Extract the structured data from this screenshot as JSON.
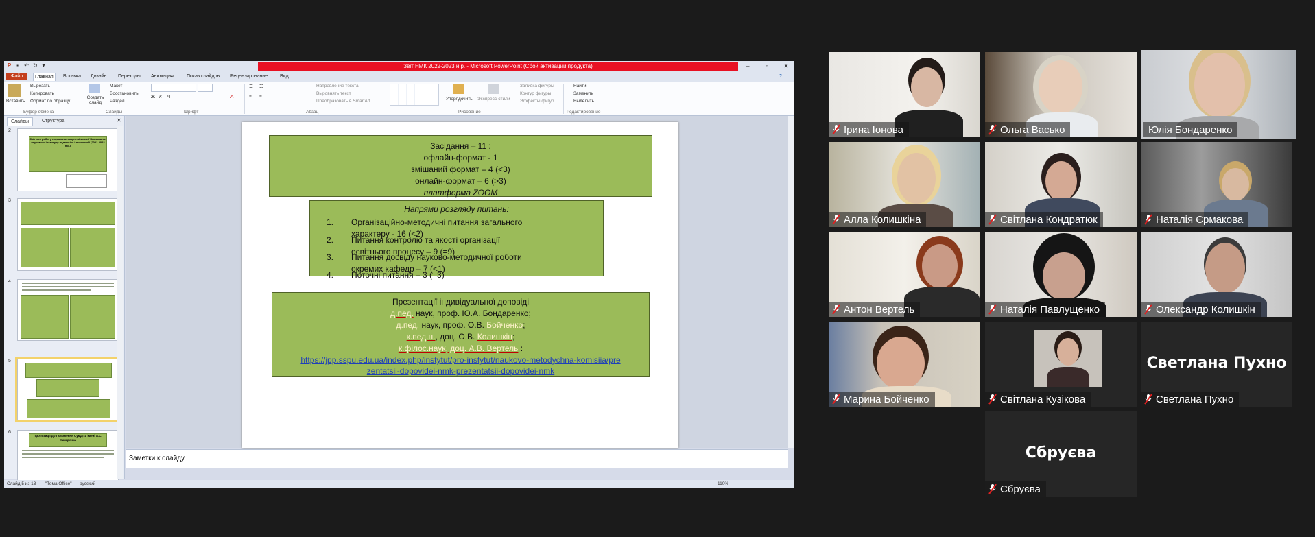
{
  "window": {
    "title": "Звіт НМК 2022-2023 н.р. - Microsoft PowerPoint (Сбой активации продукта)"
  },
  "ribbon": {
    "tabs": [
      "Файл",
      "Главная",
      "Вставка",
      "Дизайн",
      "Переходы",
      "Анимация",
      "Показ слайдов",
      "Рецензирование",
      "Вид"
    ],
    "clipboard": {
      "paste": "Вставить",
      "cut": "Вырезать",
      "copy": "Копировать",
      "format": "Формат по образцу",
      "group": "Буфер обмена"
    },
    "slides": {
      "create": "Создать слайд",
      "layout": "Макет",
      "reset": "Восстановить",
      "section": "Раздел",
      "group": "Слайды"
    },
    "font_group": "Шрифт",
    "paragraph": {
      "dir": "Направление текста",
      "align": "Выровнять текст",
      "smartart": "Преобразовать в SmartArt",
      "group": "Абзац"
    },
    "drawing": {
      "arrange": "Упорядочить",
      "styles": "Экспресс-стили",
      "fill": "Заливка фигуры",
      "outline": "Контур фигуры",
      "effects": "Эффекты фигур",
      "group": "Рисование"
    },
    "editing": {
      "find": "Найти",
      "replace": "Заменить",
      "select": "Выделить",
      "group": "Редактирование"
    }
  },
  "panel": {
    "tabs": [
      "Слайды",
      "Структура"
    ]
  },
  "thumbs": {
    "nums": [
      "2",
      "3",
      "4",
      "5",
      "6"
    ],
    "t2_title": "Звіт про роботу науково-методичної комісії Навчально-наукового інституту педагогіки і психології (2022-2023 н.р.)",
    "t6_title": "Пропозиції до Положення СумДПУ імені А.С. Макаренка"
  },
  "slide": {
    "box1": [
      "Засідання – 11 :",
      "офлайн-формат - 1",
      "змішаний формат – 4 (<3)",
      "онлайн-формат – 6 (>3)",
      "платформа ZOOM"
    ],
    "box2_title": "Напрями розгляду питань:",
    "box2_items": [
      {
        "n": "1.",
        "text": "Організаційно-методичні питання загального характеру - 16 (<2)"
      },
      {
        "n": "2.",
        "text": "Питання контролю та якості організації освітнього процесу – 9 (=9)"
      },
      {
        "n": "3.",
        "text": "Питання досвіду науково-методичної роботи окремих кафедр – 7 (<1)"
      },
      {
        "n": "4.",
        "text": "Поточні питання – 3 (=3)"
      }
    ],
    "box3": {
      "title": "Презентації індивідуальної доповіді",
      "l1_a": "д.пед.",
      "l1_b": " наук, проф. Ю.А. Бондаренко;",
      "l2_a": "д.пед.",
      "l2_b": " наук, проф. О.В. ",
      "l2_c": "Бойченко",
      ";": ";",
      "l3_a": "к.пед.н.",
      "l3_b": ", доц. О.В. ",
      "l3_c": "Колишкін",
      "l4_a": "к.філос.наук",
      "l4_b": ", доц. А.В. Вертель",
      "link": "https://jpp.sspu.edu.ua/index.php/instytut/pro-instytut/naukovo-metodychna-komisiia/prezentatsii-dopovidei-nmk-prezentatsii-dopovidei-nmk"
    }
  },
  "notes_placeholder": "Заметки к слайду",
  "status": {
    "slide": "Слайд 5 из 13",
    "theme": "\"Тема Office\"",
    "lang": "русский",
    "zoom": "110%"
  },
  "participants": [
    {
      "name": "Ірина Іонова"
    },
    {
      "name": "Ольга Васько"
    },
    {
      "name": "Юлія Бондаренко"
    },
    {
      "name": "Алла Колишкіна"
    },
    {
      "name": "Світлана Кондратюк"
    },
    {
      "name": "Наталія  Єрмакова"
    },
    {
      "name": "Антон Вертель"
    },
    {
      "name": "Наталія Павлущенко"
    },
    {
      "name": "Олександр Колишкін"
    },
    {
      "name": "Марина Бойченко"
    },
    {
      "name": "Світлана Кузікова"
    },
    {
      "name": "Светлана Пухно",
      "big": "Светлана Пухно"
    },
    {
      "name": "Сбруєва",
      "big": "Сбруєва"
    }
  ],
  "colors": {
    "slide_box": "#9bbb59",
    "active_speaker": "#e8f08a",
    "muted_mic": "#e02020"
  }
}
